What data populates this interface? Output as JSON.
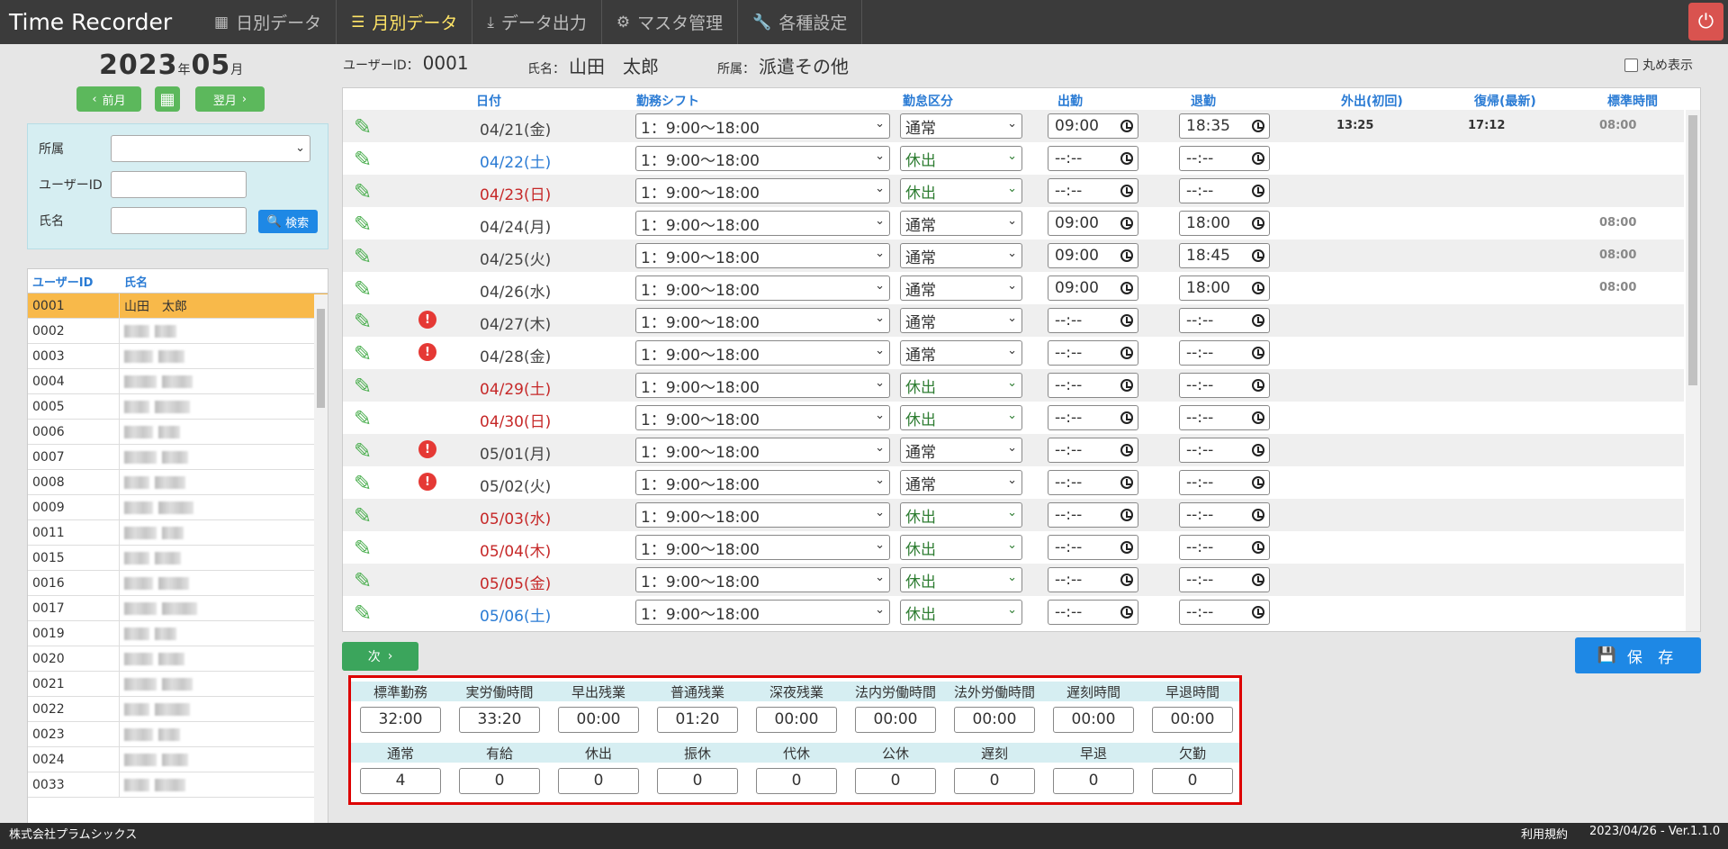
{
  "app": {
    "title": "Time Recorder"
  },
  "nav": [
    {
      "icon": "calendar-icon",
      "label": "日別データ"
    },
    {
      "icon": "list-icon",
      "label": "月別データ"
    },
    {
      "icon": "download-icon",
      "label": "データ出力"
    },
    {
      "icon": "gear-icon",
      "label": "マスタ管理"
    },
    {
      "icon": "wrench-icon",
      "label": "各種設定"
    }
  ],
  "month": {
    "year": "2023",
    "year_unit": "年",
    "month": "05",
    "month_unit": "月",
    "prev": "前月",
    "next": "翌月"
  },
  "search": {
    "dept_label": "所属",
    "uid_label": "ユーザーID",
    "name_label": "氏名",
    "button": "検索"
  },
  "userlist": {
    "headers": [
      "ユーザーID",
      "氏名"
    ],
    "selected": {
      "id": "0001",
      "name": "山田　太郎"
    },
    "ids": [
      "0002",
      "0003",
      "0004",
      "0005",
      "0006",
      "0007",
      "0008",
      "0009",
      "0011",
      "0015",
      "0016",
      "0017",
      "0019",
      "0020",
      "0021",
      "0022",
      "0023",
      "0024",
      "0033"
    ]
  },
  "info": {
    "uid_label": "ユーザーID：",
    "uid": "0001",
    "name_label": "氏名：",
    "name": "山田　太郎",
    "dept_label": "所属：",
    "dept": "派遣その他",
    "maru_label": "丸め表示"
  },
  "grid": {
    "headers": [
      "日付",
      "勤務シフト",
      "勤怠区分",
      "出勤",
      "退勤",
      "外出(初回)",
      "復帰(最新)",
      "標準時間"
    ],
    "rows": [
      {
        "date": "04/21(金)",
        "day": "wk",
        "warn": false,
        "shift": "1：9:00〜18:00",
        "kbn": "通常",
        "in": "09:00",
        "out": "18:35",
        "go": "13:25",
        "back": "17:12",
        "std": "08:00"
      },
      {
        "date": "04/22(土)",
        "day": "sat",
        "warn": false,
        "shift": "1：9:00〜18:00",
        "kbn": "休出",
        "in": "--:--",
        "out": "--:--",
        "go": "",
        "back": "",
        "std": ""
      },
      {
        "date": "04/23(日)",
        "day": "sun",
        "warn": false,
        "shift": "1：9:00〜18:00",
        "kbn": "休出",
        "in": "--:--",
        "out": "--:--",
        "go": "",
        "back": "",
        "std": ""
      },
      {
        "date": "04/24(月)",
        "day": "wk",
        "warn": false,
        "shift": "1：9:00〜18:00",
        "kbn": "通常",
        "in": "09:00",
        "out": "18:00",
        "go": "",
        "back": "",
        "std": "08:00"
      },
      {
        "date": "04/25(火)",
        "day": "wk",
        "warn": false,
        "shift": "1：9:00〜18:00",
        "kbn": "通常",
        "in": "09:00",
        "out": "18:45",
        "go": "",
        "back": "",
        "std": "08:00"
      },
      {
        "date": "04/26(水)",
        "day": "wk",
        "warn": false,
        "shift": "1：9:00〜18:00",
        "kbn": "通常",
        "in": "09:00",
        "out": "18:00",
        "go": "",
        "back": "",
        "std": "08:00"
      },
      {
        "date": "04/27(木)",
        "day": "wk",
        "warn": true,
        "shift": "1：9:00〜18:00",
        "kbn": "通常",
        "in": "--:--",
        "out": "--:--",
        "go": "",
        "back": "",
        "std": ""
      },
      {
        "date": "04/28(金)",
        "day": "wk",
        "warn": true,
        "shift": "1：9:00〜18:00",
        "kbn": "通常",
        "in": "--:--",
        "out": "--:--",
        "go": "",
        "back": "",
        "std": ""
      },
      {
        "date": "04/29(土)",
        "day": "sun",
        "warn": false,
        "shift": "1：9:00〜18:00",
        "kbn": "休出",
        "in": "--:--",
        "out": "--:--",
        "go": "",
        "back": "",
        "std": ""
      },
      {
        "date": "04/30(日)",
        "day": "sun",
        "warn": false,
        "shift": "1：9:00〜18:00",
        "kbn": "休出",
        "in": "--:--",
        "out": "--:--",
        "go": "",
        "back": "",
        "std": ""
      },
      {
        "date": "05/01(月)",
        "day": "wk",
        "warn": true,
        "shift": "1：9:00〜18:00",
        "kbn": "通常",
        "in": "--:--",
        "out": "--:--",
        "go": "",
        "back": "",
        "std": ""
      },
      {
        "date": "05/02(火)",
        "day": "wk",
        "warn": true,
        "shift": "1：9:00〜18:00",
        "kbn": "通常",
        "in": "--:--",
        "out": "--:--",
        "go": "",
        "back": "",
        "std": ""
      },
      {
        "date": "05/03(水)",
        "day": "sun",
        "warn": false,
        "shift": "1：9:00〜18:00",
        "kbn": "休出",
        "in": "--:--",
        "out": "--:--",
        "go": "",
        "back": "",
        "std": ""
      },
      {
        "date": "05/04(木)",
        "day": "sun",
        "warn": false,
        "shift": "1：9:00〜18:00",
        "kbn": "休出",
        "in": "--:--",
        "out": "--:--",
        "go": "",
        "back": "",
        "std": ""
      },
      {
        "date": "05/05(金)",
        "day": "sun",
        "warn": false,
        "shift": "1：9:00〜18:00",
        "kbn": "休出",
        "in": "--:--",
        "out": "--:--",
        "go": "",
        "back": "",
        "std": ""
      },
      {
        "date": "05/06(土)",
        "day": "sat",
        "warn": false,
        "shift": "1：9:00〜18:00",
        "kbn": "休出",
        "in": "--:--",
        "out": "--:--",
        "go": "",
        "back": "",
        "std": ""
      }
    ]
  },
  "buttons": {
    "next": "次",
    "save": "保 存"
  },
  "summary": {
    "row1": [
      {
        "label": "標準勤務",
        "value": "32:00"
      },
      {
        "label": "実労働時間",
        "value": "33:20"
      },
      {
        "label": "早出残業",
        "value": "00:00"
      },
      {
        "label": "普通残業",
        "value": "01:20"
      },
      {
        "label": "深夜残業",
        "value": "00:00"
      },
      {
        "label": "法内労働時間",
        "value": "00:00"
      },
      {
        "label": "法外労働時間",
        "value": "00:00"
      },
      {
        "label": "遅刻時間",
        "value": "00:00"
      },
      {
        "label": "早退時間",
        "value": "00:00"
      }
    ],
    "row2": [
      {
        "label": "通常",
        "value": "4"
      },
      {
        "label": "有給",
        "value": "0"
      },
      {
        "label": "休出",
        "value": "0"
      },
      {
        "label": "振休",
        "value": "0"
      },
      {
        "label": "代休",
        "value": "0"
      },
      {
        "label": "公休",
        "value": "0"
      },
      {
        "label": "遅刻",
        "value": "0"
      },
      {
        "label": "早退",
        "value": "0"
      },
      {
        "label": "欠勤",
        "value": "0"
      }
    ]
  },
  "footer": {
    "company": "株式会社プラムシックス",
    "tos": "利用規約",
    "version": "2023/04/26 - Ver.1.1.0"
  }
}
